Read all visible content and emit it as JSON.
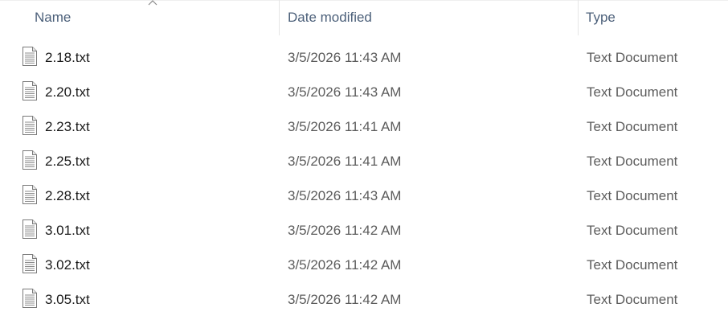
{
  "columns": {
    "name": "Name",
    "date_modified": "Date modified",
    "type": "Type"
  },
  "sort": {
    "column": "name",
    "direction": "ascending",
    "icon": "chevron-up-icon"
  },
  "files": [
    {
      "name": "2.18.txt",
      "date": "3/5/2026 11:43 AM",
      "type": "Text Document",
      "icon": "text-file-icon"
    },
    {
      "name": "2.20.txt",
      "date": "3/5/2026 11:43 AM",
      "type": "Text Document",
      "icon": "text-file-icon"
    },
    {
      "name": "2.23.txt",
      "date": "3/5/2026 11:41 AM",
      "type": "Text Document",
      "icon": "text-file-icon"
    },
    {
      "name": "2.25.txt",
      "date": "3/5/2026 11:41 AM",
      "type": "Text Document",
      "icon": "text-file-icon"
    },
    {
      "name": "2.28.txt",
      "date": "3/5/2026 11:43 AM",
      "type": "Text Document",
      "icon": "text-file-icon"
    },
    {
      "name": "3.01.txt",
      "date": "3/5/2026 11:42 AM",
      "type": "Text Document",
      "icon": "text-file-icon"
    },
    {
      "name": "3.02.txt",
      "date": "3/5/2026 11:42 AM",
      "type": "Text Document",
      "icon": "text-file-icon"
    },
    {
      "name": "3.05.txt",
      "date": "3/5/2026 11:42 AM",
      "type": "Text Document",
      "icon": "text-file-icon"
    }
  ]
}
